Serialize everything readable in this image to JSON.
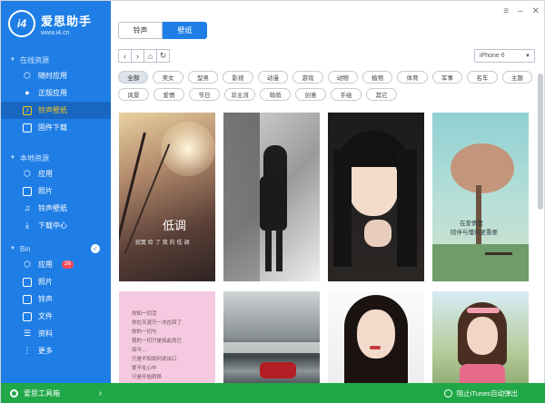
{
  "app": {
    "name": "爱思助手",
    "url": "www.i4.cn",
    "logo_mark": "i4"
  },
  "sidebar": {
    "sections": [
      {
        "title": "在线资源",
        "items": [
          {
            "label": "随时应用",
            "icon": "cube-icon"
          },
          {
            "label": "正版应用",
            "icon": "apple-icon"
          },
          {
            "label": "铃声壁纸",
            "icon": "music-icon",
            "active": true
          },
          {
            "label": "固件下载",
            "icon": "box-icon"
          }
        ]
      },
      {
        "title": "本地资源",
        "items": [
          {
            "label": "应用",
            "icon": "app-icon"
          },
          {
            "label": "照片",
            "icon": "photo-icon"
          },
          {
            "label": "铃声壁纸",
            "icon": "ringtone-icon"
          },
          {
            "label": "下载中心",
            "icon": "download-icon"
          }
        ]
      },
      {
        "title": "Bin",
        "items": [
          {
            "label": "应用",
            "icon": "app-icon",
            "badge": "26"
          },
          {
            "label": "照片",
            "icon": "photo-icon"
          },
          {
            "label": "铃声",
            "icon": "bell-icon"
          },
          {
            "label": "文件",
            "icon": "file-icon"
          },
          {
            "label": "资料",
            "icon": "contact-icon"
          },
          {
            "label": "更多",
            "icon": "more-icon"
          }
        ]
      }
    ],
    "footer": {
      "label": "爱思工具箱"
    }
  },
  "tabs": [
    {
      "label": "铃声",
      "active": false
    },
    {
      "label": "壁纸",
      "active": true
    }
  ],
  "device_select": {
    "value": "iPhone 6"
  },
  "categories_row1": [
    "全部",
    "美女",
    "型男",
    "影视",
    "动漫",
    "游戏",
    "动物",
    "植物",
    "体育",
    "军事",
    "名车",
    "主题"
  ],
  "categories_row2": [
    "风景",
    "爱情",
    "节日",
    "非主流",
    "萌萌",
    "创意",
    "手绘",
    "其它"
  ],
  "active_category": "全部",
  "thumbnails": {
    "t1_title": "低调",
    "t1_caption": "寂寞 给 了 我 的 低 调",
    "t4_line1": "在爱情里",
    "t4_line2": "陪伴与懂得更重要",
    "t5_lines": [
      "你知一切活",
      "你在天涯只一次在回了",
      "你的一切与",
      "我的一切只是如此而已",
      "如今...",
      "只是不知如何说出口",
      "爱不在心中",
      "只是开始转移"
    ]
  },
  "status_bar": {
    "label": "阻止iTunes自动弹出"
  },
  "colors": {
    "sidebar": "#1f7ee6",
    "active_item": "#f5c518",
    "status": "#20a848"
  }
}
